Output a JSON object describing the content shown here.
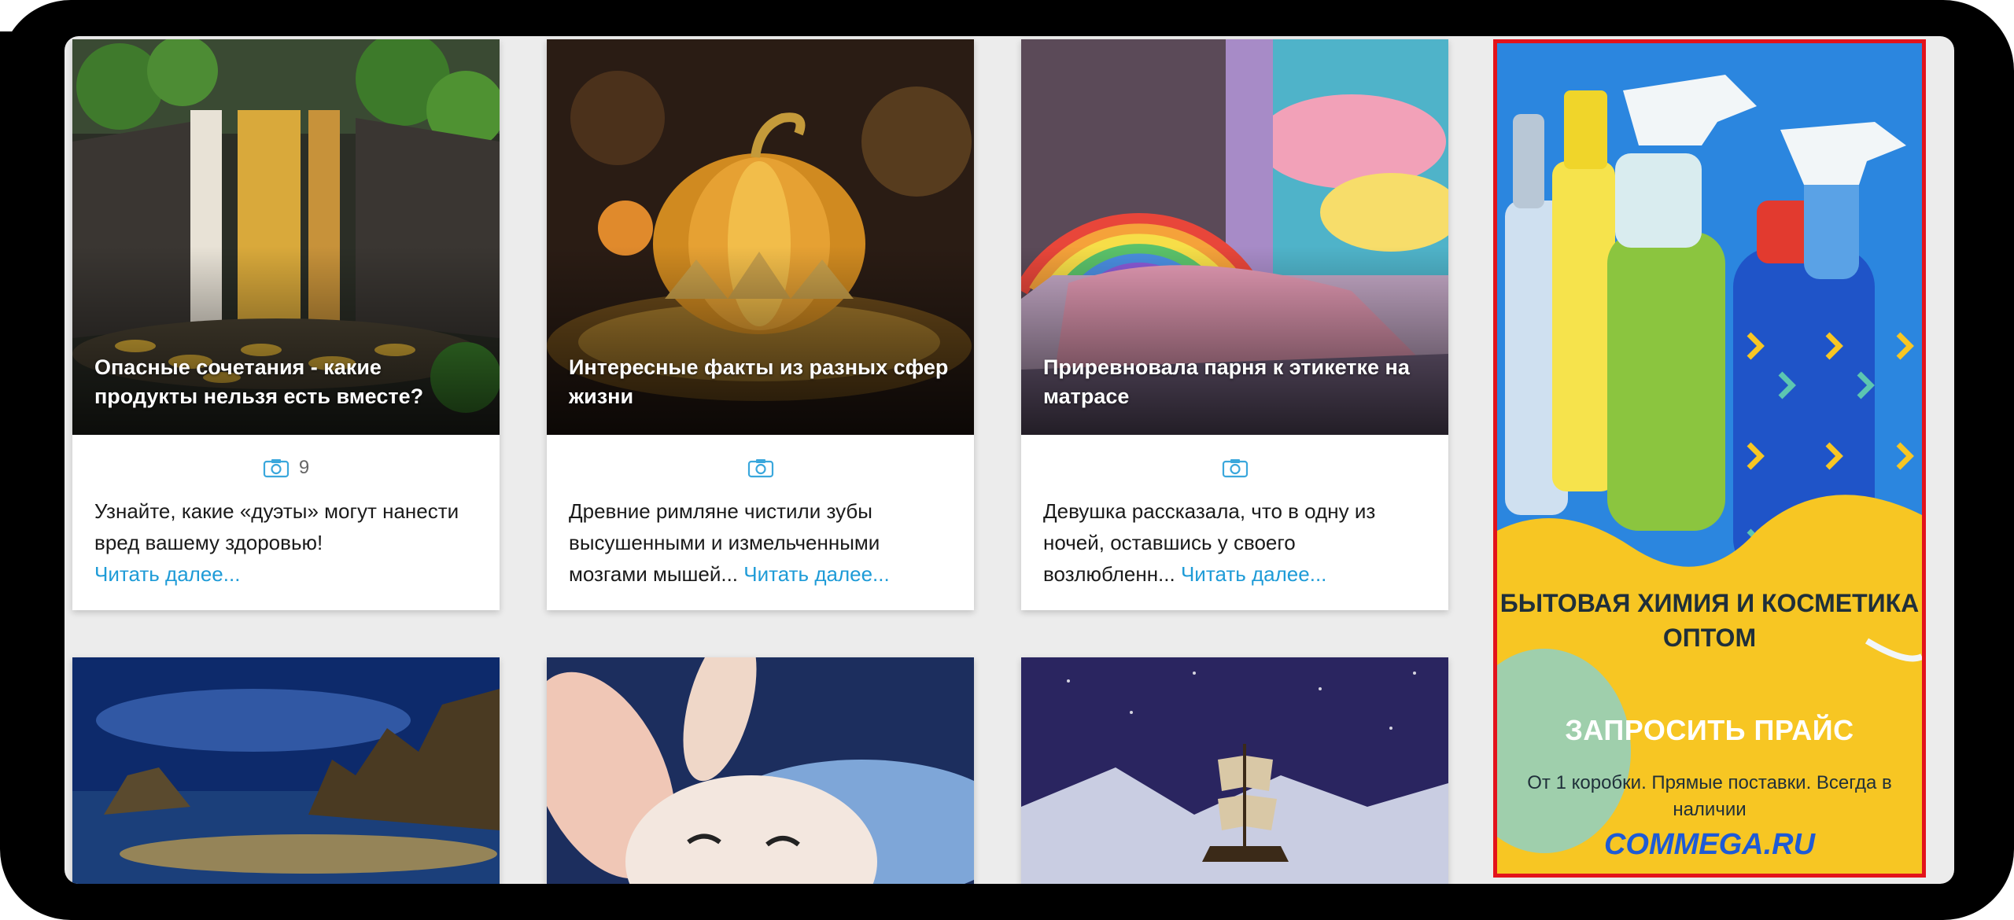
{
  "cards": [
    {
      "title": "Опасные сочетания - какие продукты нельзя есть вместе?",
      "photo_count": "9",
      "excerpt": "Узнайте, какие «дуэты» могут нанести вред вашему здоровью!",
      "read_more": "Читать далее..."
    },
    {
      "title": "Интересные факты из разных сфер жизни",
      "photo_count": "",
      "excerpt": "Древние римляне чистили зубы высушенными и измельченными мозгами мышей...",
      "read_more": "Читать далее..."
    },
    {
      "title": "Приревновала парня к этикетке на матрасе",
      "photo_count": "",
      "excerpt": "Девушка рассказала, что в одну из ночей, оставшись у своего возлюбленн...",
      "read_more": "Читать далее..."
    }
  ],
  "ad": {
    "heading": "БЫТОВАЯ ХИМИЯ И КОСМЕТИКА ОПТОМ",
    "button": "ЗАПРОСИТЬ ПРАЙС",
    "subtext": "От 1 коробки. Прямые поставки. Всегда в наличии",
    "site": "COMMEGA.RU"
  },
  "icons": {
    "photo": "camera-icon"
  },
  "colors": {
    "link": "#1e9bd7",
    "ad_border": "#e3131b",
    "ad_button": "#e5371e",
    "ad_yellow": "#f7c623",
    "ad_site": "#1e5bd6"
  }
}
